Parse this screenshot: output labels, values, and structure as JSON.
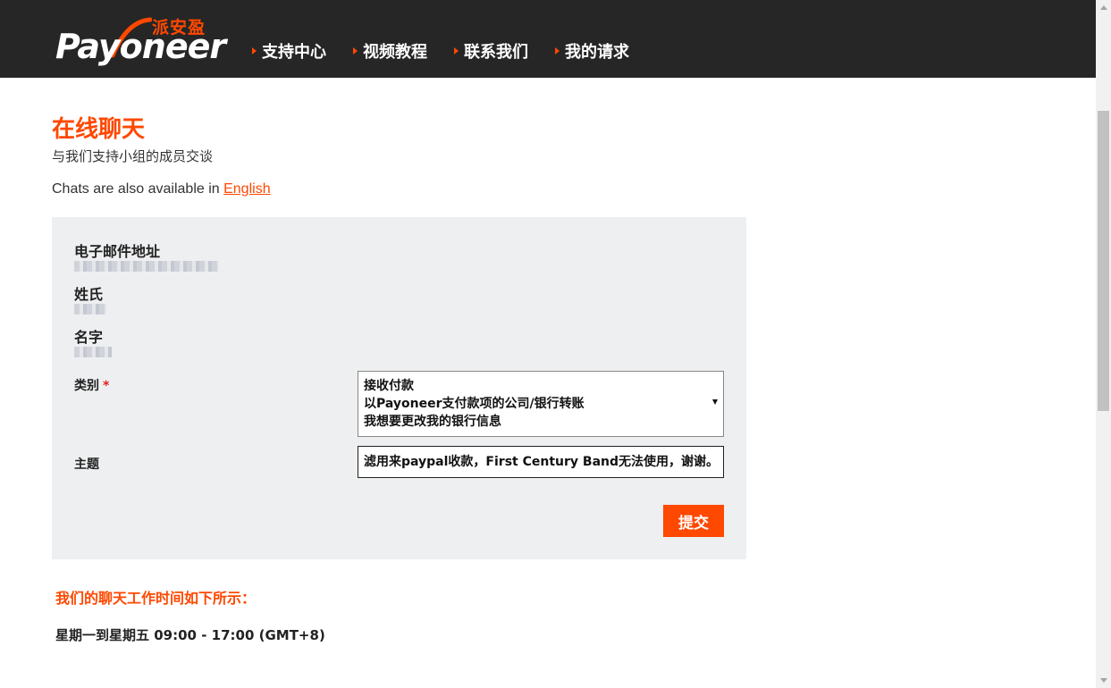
{
  "header": {
    "logo_text": "Payoneer",
    "logo_cn": "派安盈",
    "nav": [
      {
        "label": "支持中心"
      },
      {
        "label": "视频教程"
      },
      {
        "label": "联系我们"
      },
      {
        "label": "我的请求"
      }
    ]
  },
  "main": {
    "title": "在线聊天",
    "subtitle": "与我们支持小组的成员交谈",
    "also_text": "Chats are also available in ",
    "also_link": "English"
  },
  "form": {
    "email_label": "电子邮件地址",
    "lastname_label": "姓氏",
    "firstname_label": "名字",
    "category_label": "类别",
    "required_mark": "*",
    "category_options": [
      "接收付款",
      "以Payoneer支付款项的公司/银行转账",
      "我想要更改我的银行信息"
    ],
    "subject_label": "主题",
    "subject_value": "滤用来paypal收款，First Century Band无法使用，谢谢。",
    "submit_label": "提交"
  },
  "hours": {
    "title": "我们的聊天工作时间如下所示：",
    "text": "星期一到星期五 09:00 - 17:00 (GMT+8)"
  },
  "colors": {
    "accent": "#ff4800",
    "header_bg": "#262626",
    "panel_bg": "#eeeff0"
  }
}
